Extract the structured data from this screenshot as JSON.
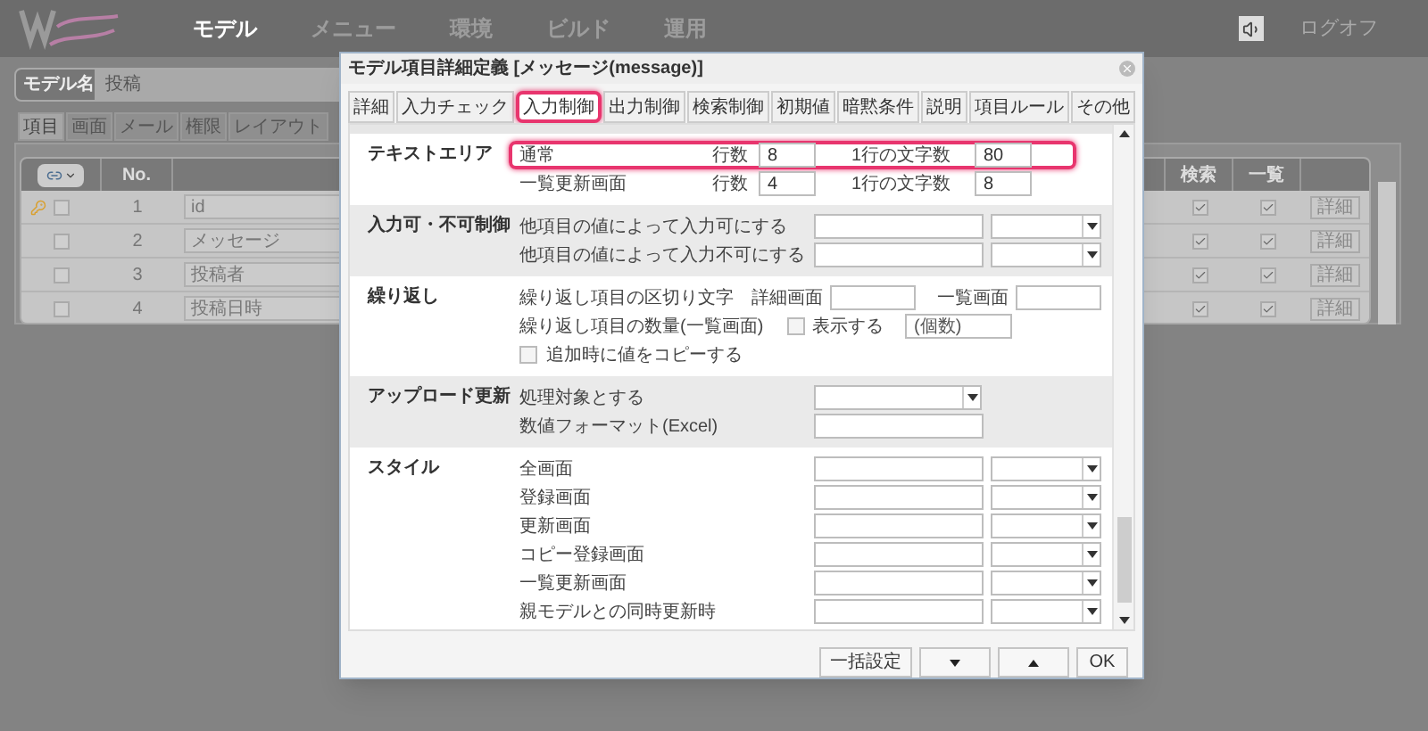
{
  "nav": {
    "items": [
      {
        "label": "モデル",
        "selected": true
      },
      {
        "label": "メニュー",
        "selected": false
      },
      {
        "label": "環境",
        "selected": false
      },
      {
        "label": "ビルド",
        "selected": false
      },
      {
        "label": "運用",
        "selected": false
      }
    ],
    "logoff": "ログオフ"
  },
  "model_name": {
    "label": "モデル名",
    "value": "投稿"
  },
  "tabs": [
    {
      "label": "項目",
      "selected": true
    },
    {
      "label": "画面",
      "selected": false
    },
    {
      "label": "メール",
      "selected": false
    },
    {
      "label": "権限",
      "selected": false
    },
    {
      "label": "レイアウト",
      "selected": false
    }
  ],
  "table": {
    "columns": [
      "No.",
      "検索",
      "一覧"
    ],
    "rows": [
      {
        "key": true,
        "checked": false,
        "no": "1",
        "name": "id",
        "search": true,
        "list": true,
        "action": "詳細"
      },
      {
        "key": false,
        "checked": false,
        "no": "2",
        "name": "メッセージ",
        "search": true,
        "list": true,
        "action": "詳細"
      },
      {
        "key": false,
        "checked": false,
        "no": "3",
        "name": "投稿者",
        "search": true,
        "list": true,
        "action": "詳細"
      },
      {
        "key": false,
        "checked": false,
        "no": "4",
        "name": "投稿日時",
        "search": true,
        "list": true,
        "action": "詳細"
      }
    ]
  },
  "dialog": {
    "title": "モデル項目詳細定義 [メッセージ(message)]",
    "tabs": [
      {
        "label": "詳細",
        "selected": false,
        "highlighted": false
      },
      {
        "label": "入力チェック",
        "selected": false,
        "highlighted": false
      },
      {
        "label": "入力制御",
        "selected": true,
        "highlighted": true
      },
      {
        "label": "出力制御",
        "selected": false,
        "highlighted": false
      },
      {
        "label": "検索制御",
        "selected": false,
        "highlighted": false
      },
      {
        "label": "初期値",
        "selected": false,
        "highlighted": false
      },
      {
        "label": "暗黙条件",
        "selected": false,
        "highlighted": false
      },
      {
        "label": "説明",
        "selected": false,
        "highlighted": false
      },
      {
        "label": "項目ルール",
        "selected": false,
        "highlighted": false
      },
      {
        "label": "その他",
        "selected": false,
        "highlighted": false
      }
    ],
    "sections": [
      {
        "title": "テキストエリア",
        "rows": [
          {
            "kind": "size",
            "label": "通常",
            "highlighted": true,
            "rows_label": "行数",
            "rows_value": "8",
            "chars_label": "1行の文字数",
            "chars_value": "80"
          },
          {
            "kind": "size",
            "label": "一覧更新画面",
            "highlighted": false,
            "rows_label": "行数",
            "rows_value": "4",
            "chars_label": "1行の文字数",
            "chars_value": "8"
          }
        ]
      },
      {
        "title": "入力可・不可制御",
        "rows": [
          {
            "kind": "input_select",
            "label": "他項目の値によって入力可にする"
          },
          {
            "kind": "input_select",
            "label": "他項目の値によって入力不可にする"
          }
        ]
      },
      {
        "title": "繰り返し",
        "rows": [
          {
            "kind": "pair",
            "label": "繰り返し項目の区切り文字",
            "first_label": "詳細画面",
            "second_label": "一覧画面"
          },
          {
            "kind": "count",
            "label": "繰り返し項目の数量(一覧画面)",
            "checkbox_label": "表示する",
            "checked": false,
            "placeholder": "(個数)"
          },
          {
            "kind": "checkbox",
            "label": "追加時に値をコピーする",
            "checked": false
          }
        ]
      },
      {
        "title": "アップロード更新",
        "rows": [
          {
            "kind": "select",
            "label": "処理対象とする"
          },
          {
            "kind": "input",
            "label": "数値フォーマット(Excel)"
          }
        ]
      },
      {
        "title": "スタイル",
        "rows": [
          {
            "kind": "input_select",
            "label": "全画面"
          },
          {
            "kind": "input_select",
            "label": "登録画面"
          },
          {
            "kind": "input_select",
            "label": "更新画面"
          },
          {
            "kind": "input_select",
            "label": "コピー登録画面"
          },
          {
            "kind": "input_select",
            "label": "一覧更新画面"
          },
          {
            "kind": "input_select",
            "label": "親モデルとの同時更新時"
          }
        ]
      }
    ],
    "buttons": [
      {
        "kind": "text",
        "label": "一括設定"
      },
      {
        "kind": "down"
      },
      {
        "kind": "up"
      },
      {
        "kind": "text",
        "label": "OK"
      }
    ]
  }
}
